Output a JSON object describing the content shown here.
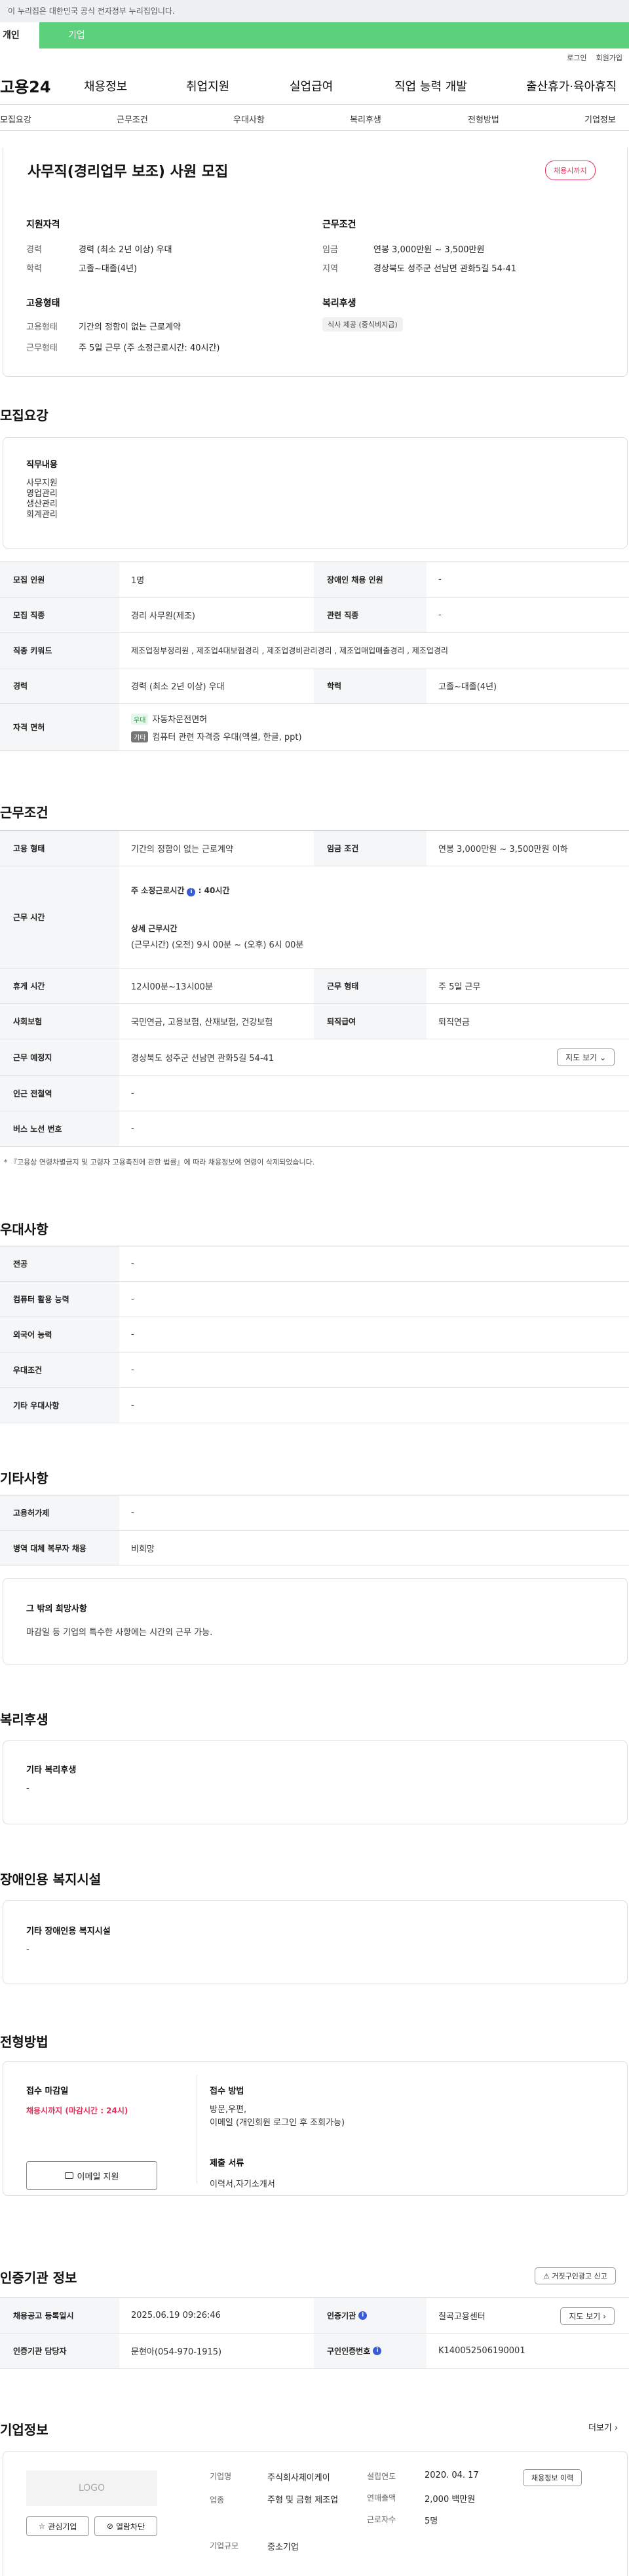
{
  "gov_banner": "이 누리집은 대한민국 공식 전자정부 누리집입니다.",
  "user_tabs": [
    "개인",
    "기업"
  ],
  "util_links": [
    "로그인",
    "회원가입"
  ],
  "logo": "고용24",
  "gnb": [
    "채용정보",
    "취업지원",
    "실업급여",
    "직업 능력 개발",
    "출산휴가·육아휴직"
  ],
  "subnav": [
    "모집요강",
    "근무조건",
    "우대사항",
    "복리후생",
    "전형방법",
    "기업정보"
  ],
  "job": {
    "title": "사무직(경리업무 보조) 사원 모집",
    "badge": "채용시까지",
    "qual_title": "지원자격",
    "career_label": "경력",
    "career": "경력 (최소 2년 이상) 우대",
    "edu_label": "학력",
    "edu": "고졸~대졸(4년)",
    "emp_title": "고용형태",
    "emp_label": "고용형태",
    "emp": "기간의 정함이 없는 근로계약",
    "work_label": "근무형태",
    "work": "주 5일 근무 (주 소정근로시간: 40시간)",
    "cond_title": "근무조건",
    "wage_label": "임금",
    "wage": "연봉 3,000만원 ~ 3,500만원",
    "region_label": "지역",
    "region": "경상북도 성주군 선남면 관화5길 54-41",
    "welfare_title": "복리후생",
    "welfare_tag": "식사 제공 (중식비지급)"
  },
  "recruit": {
    "section": "모집요강",
    "duty_title": "직무내용",
    "duties": [
      "사무지원",
      "영업관리",
      "생산관리",
      "회계관리"
    ],
    "rows": {
      "headcount_l": "모집 인원",
      "headcount": "1명",
      "disabled_l": "장애인 채용 인원",
      "disabled": "-",
      "job_l": "모집 직종",
      "job": "경리 사무원(제조)",
      "rel_l": "관련 직종",
      "rel": "-",
      "kw_l": "직종 키워드",
      "kw": "제조업정부정리원 , 제조업4대보험경리 , 제조업경비관리경리 , 제조업매입매출경리 , 제조업경리",
      "career_l": "경력",
      "career": "경력 (최소 2년 이상) 우대",
      "edu_l": "학력",
      "edu": "고졸~대졸(4년)",
      "lic_l": "자격 면허",
      "lic_tag1": "우대",
      "lic1": "자동차운전면허",
      "lic_tag2": "기타",
      "lic2": "컴퓨터 관련 자격증 우대(엑셀, 한글, ppt)"
    }
  },
  "conditions": {
    "section": "근무조건",
    "type_l": "고용 형태",
    "type": "기간의 정함이 없는 근로계약",
    "wage_l": "임금 조건",
    "wage": "연봉 3,000만원 ~ 3,500만원 이하",
    "time_l": "근무 시간",
    "time_week": "주 소정근로시간",
    "time_week_v": ": 40시간",
    "time_detail_t": "상세 근무시간",
    "time_detail": "(근무시간) (오전) 9시 00분 ~ (오후) 6시 00분",
    "rest_l": "휴게 시간",
    "rest": "12시00분~13시00분",
    "form_l": "근무 형태",
    "form": "주 5일 근무",
    "ins_l": "사회보험",
    "ins": "국민연금, 고용보험, 산재보험, 건강보험",
    "ret_l": "퇴직급여",
    "ret": "퇴직연금",
    "place_l": "근무 예정지",
    "place": "경상북도 성주군 선남면 관화5길 54-41",
    "map_btn": "지도 보기",
    "sub_l": "인근 전철역",
    "sub": "-",
    "bus_l": "버스 노선 번호",
    "bus": "-",
    "note": "* 『고용상 연령차별금지 및 고령자 고용촉진에 관한 법률』에 따라 채용정보에 연령이 삭제되었습니다."
  },
  "pref": {
    "section": "우대사항",
    "rows": [
      {
        "l": "전공",
        "v": "-"
      },
      {
        "l": "컴퓨터 활용 능력",
        "v": "-"
      },
      {
        "l": "외국어 능력",
        "v": "-"
      },
      {
        "l": "우대조건",
        "v": "-"
      },
      {
        "l": "기타 우대사항",
        "v": "-"
      }
    ]
  },
  "etc": {
    "section": "기타사항",
    "rows": [
      {
        "l": "고용허가제",
        "v": "-"
      },
      {
        "l": "병역 대체 복무자 채용",
        "v": "비희망"
      }
    ],
    "box_title": "그 밖의 희망사항",
    "box_text": "마감일 등 기업의 특수한 사항에는 시간외 근무 가능."
  },
  "welfare": {
    "section": "복리후생",
    "title": "기타 복리후생",
    "v": "-"
  },
  "facility": {
    "section": "장애인용 복지시설",
    "title": "기타 장애인용 복지시설",
    "v": "-"
  },
  "process": {
    "section": "전형방법",
    "deadline_t": "접수 마감일",
    "deadline": "채용시까지 (마감시간 : 24시)",
    "email_btn": "이메일 지원",
    "method_t": "접수 방법",
    "method1": "방문,우편,",
    "method2": "이메일 (개인회원 로그인 후 조회가능)",
    "docs_t": "제출 서류",
    "docs": "이력서,자기소개서"
  },
  "agency": {
    "section": "인증기관 정보",
    "report_btn": "거짓구인광고 신고",
    "date_l": "채용공고 등록일시",
    "date": "2025.06.19 09:26:46",
    "org_l": "인증기관",
    "org": "칠곡고용센터",
    "map_btn": "지도 보기",
    "mgr_l": "인증기관 담당자",
    "mgr": "문현아(054-970-1915)",
    "no_l": "구인인증번호",
    "no": "K140052506190001"
  },
  "company": {
    "section": "기업정보",
    "more": "더보기",
    "logo": "LOGO",
    "fav_btn": "관심기업",
    "block_btn": "열람차단",
    "name_l": "기업명",
    "name": "주식회사체이케이",
    "ind_l": "업종",
    "ind": "주형 및 금형 제조업",
    "size_l": "기업규모",
    "size": "중소기업",
    "est_l": "설립연도",
    "est": "2020. 04. 17",
    "sales_l": "연매출액",
    "sales": "2,000 백만원",
    "emp_l": "근로자수",
    "emp": "5명",
    "hist_btn": "채용정보 이력"
  }
}
